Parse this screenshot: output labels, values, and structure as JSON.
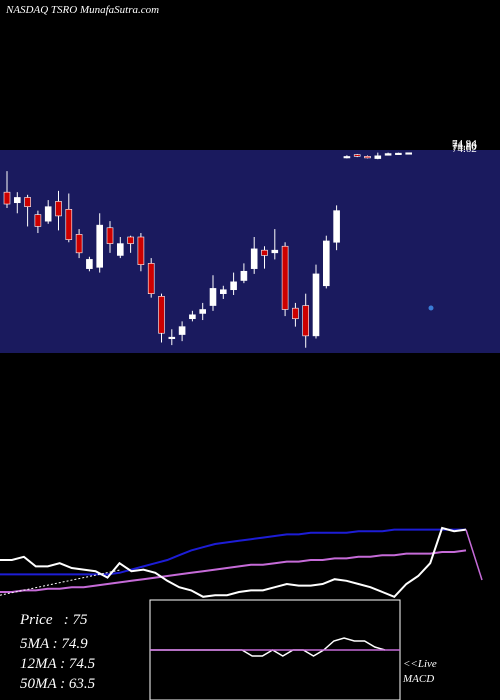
{
  "header": {
    "title": "NASDAQ TSRO MunafaSutra.com"
  },
  "stats": [
    {
      "label": "Price",
      "value": "75"
    },
    {
      "label": "5MA",
      "value": "74.9"
    },
    {
      "label": "12MA",
      "value": "74.5"
    },
    {
      "label": "50MA",
      "value": "63.5"
    }
  ],
  "macd_panel": {
    "live_label": "<<Live",
    "macd_label": "MACD"
  },
  "price_tags": [
    "74.94",
    "74.86",
    "74.80",
    "74.62"
  ],
  "colors": {
    "background": "#000000",
    "price_panel": "#1a1a5e",
    "up_candle": "#ffffff",
    "down_candle": "#cc0000",
    "ma_blue": "#1d1dd6",
    "ma_violet": "#c66bd8",
    "line_white": "#ffffff"
  },
  "chart_data": [
    {
      "type": "candlestick",
      "title": "NASDAQ TSRO",
      "candles": [
        {
          "o": 72.0,
          "c": 71.1,
          "h": 73.6,
          "l": 70.8
        },
        {
          "o": 71.2,
          "c": 71.6,
          "h": 72.0,
          "l": 70.4
        },
        {
          "o": 71.6,
          "c": 70.9,
          "h": 71.8,
          "l": 69.4
        },
        {
          "o": 70.3,
          "c": 69.4,
          "h": 70.6,
          "l": 68.9
        },
        {
          "o": 69.8,
          "c": 70.9,
          "h": 71.4,
          "l": 69.6
        },
        {
          "o": 71.3,
          "c": 70.2,
          "h": 72.1,
          "l": 69.1
        },
        {
          "o": 70.7,
          "c": 68.4,
          "h": 71.9,
          "l": 68.2
        },
        {
          "o": 68.8,
          "c": 67.4,
          "h": 69.2,
          "l": 67.0
        },
        {
          "o": 66.2,
          "c": 66.9,
          "h": 67.1,
          "l": 66.0
        },
        {
          "o": 66.3,
          "c": 69.5,
          "h": 70.4,
          "l": 65.9
        },
        {
          "o": 69.3,
          "c": 68.1,
          "h": 69.8,
          "l": 67.4
        },
        {
          "o": 67.2,
          "c": 68.1,
          "h": 68.6,
          "l": 67.0
        },
        {
          "o": 68.6,
          "c": 68.1,
          "h": 68.7,
          "l": 67.4
        },
        {
          "o": 68.6,
          "c": 66.5,
          "h": 68.9,
          "l": 66.0
        },
        {
          "o": 66.6,
          "c": 64.3,
          "h": 67.0,
          "l": 64.0
        },
        {
          "o": 64.1,
          "c": 61.3,
          "h": 64.3,
          "l": 60.6
        },
        {
          "o": 60.9,
          "c": 61.0,
          "h": 61.6,
          "l": 60.4
        },
        {
          "o": 61.2,
          "c": 61.8,
          "h": 62.2,
          "l": 60.7
        },
        {
          "o": 62.4,
          "c": 62.7,
          "h": 63.0,
          "l": 62.2
        },
        {
          "o": 62.8,
          "c": 63.1,
          "h": 63.6,
          "l": 62.3
        },
        {
          "o": 63.4,
          "c": 64.7,
          "h": 65.7,
          "l": 63.0
        },
        {
          "o": 64.3,
          "c": 64.6,
          "h": 64.9,
          "l": 63.9
        },
        {
          "o": 64.6,
          "c": 65.2,
          "h": 65.9,
          "l": 64.2
        },
        {
          "o": 65.3,
          "c": 66.0,
          "h": 66.6,
          "l": 65.1
        },
        {
          "o": 66.2,
          "c": 67.7,
          "h": 68.6,
          "l": 65.8
        },
        {
          "o": 67.6,
          "c": 67.2,
          "h": 67.9,
          "l": 66.2
        },
        {
          "o": 67.4,
          "c": 67.6,
          "h": 69.2,
          "l": 66.9
        },
        {
          "o": 67.9,
          "c": 63.1,
          "h": 68.2,
          "l": 62.6
        },
        {
          "o": 63.2,
          "c": 62.4,
          "h": 63.6,
          "l": 61.8
        },
        {
          "o": 63.4,
          "c": 61.1,
          "h": 64.3,
          "l": 60.2
        },
        {
          "o": 61.1,
          "c": 65.8,
          "h": 66.5,
          "l": 60.9
        },
        {
          "o": 64.9,
          "c": 68.3,
          "h": 68.7,
          "l": 64.7
        },
        {
          "o": 68.2,
          "c": 70.6,
          "h": 71.0,
          "l": 67.6
        },
        {
          "o": 74.68,
          "c": 74.71,
          "h": 74.8,
          "l": 74.56
        },
        {
          "o": 74.85,
          "c": 74.72,
          "h": 74.9,
          "l": 74.66
        },
        {
          "o": 74.72,
          "c": 74.6,
          "h": 74.78,
          "l": 74.56
        },
        {
          "o": 74.55,
          "c": 74.76,
          "h": 75.0,
          "l": 74.5
        },
        {
          "o": 74.8,
          "c": 74.93,
          "h": 75.0,
          "l": 74.78
        },
        {
          "o": 74.92,
          "c": 74.96,
          "h": 75.0,
          "l": 74.9
        },
        {
          "o": 74.95,
          "c": 74.99,
          "h": 75.0,
          "l": 74.93
        }
      ]
    },
    {
      "type": "line",
      "title": "Moving averages",
      "series": [
        {
          "name": "blue",
          "color": "#1d1dd6",
          "values": [
            41,
            41,
            41,
            41,
            41,
            41,
            41,
            41,
            41,
            41,
            42,
            44,
            46,
            48,
            50,
            53,
            56,
            58,
            60,
            61,
            62,
            63,
            64,
            65,
            66,
            66,
            67,
            67,
            67,
            67,
            68,
            68,
            68,
            69,
            69,
            69,
            69,
            69,
            69,
            69
          ]
        },
        {
          "name": "violet",
          "color": "#c66bd8",
          "values": [
            30,
            30,
            31,
            31,
            32,
            32,
            33,
            33,
            34,
            35,
            36,
            37,
            38,
            39,
            40,
            41,
            42,
            43,
            44,
            45,
            46,
            47,
            47,
            48,
            49,
            49,
            50,
            50,
            51,
            51,
            52,
            52,
            53,
            53,
            54,
            54,
            54,
            55,
            55,
            56
          ]
        },
        {
          "name": "white",
          "color": "#ffffff",
          "values": [
            50,
            50,
            52,
            46,
            46,
            48,
            45,
            44,
            43,
            39,
            48,
            43,
            44,
            42,
            37,
            33,
            31,
            27,
            28,
            28,
            30,
            31,
            31,
            33,
            35,
            34,
            34,
            35,
            38,
            37,
            35,
            33,
            30,
            27,
            35,
            40,
            48,
            70,
            68,
            69
          ]
        }
      ]
    },
    {
      "type": "line",
      "title": "MACD",
      "series": [
        {
          "name": "macd",
          "color": "#ffffff",
          "values": [
            0,
            0,
            0,
            0,
            0,
            0,
            0,
            0,
            0,
            0,
            -10,
            -10,
            0,
            -10,
            0,
            0,
            -10,
            0,
            15,
            20,
            15,
            15,
            5,
            0
          ]
        }
      ]
    }
  ]
}
